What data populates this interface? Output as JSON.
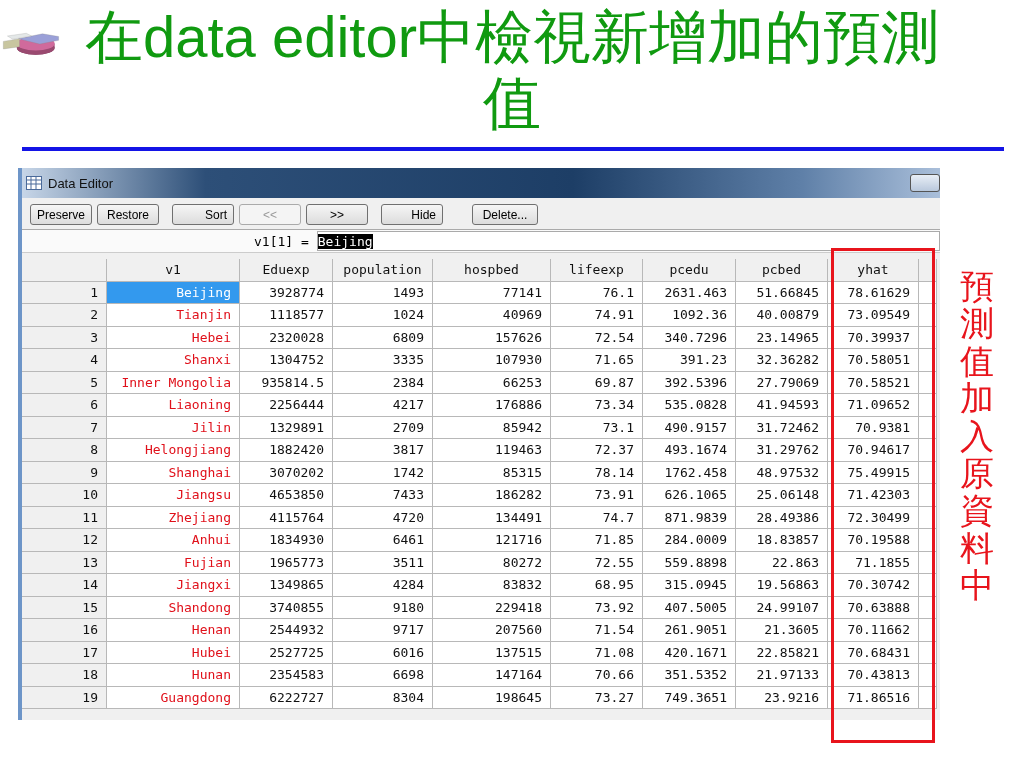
{
  "slide_title": "在data editor中檢視新增加的預測值",
  "window": {
    "title": "Data Editor"
  },
  "toolbar": [
    {
      "label": "Preserve",
      "disabled": false
    },
    {
      "label": "Restore",
      "disabled": false
    },
    {
      "label": "Sort",
      "disabled": false
    },
    {
      "label": "<<",
      "disabled": true
    },
    {
      "label": ">>",
      "disabled": false
    },
    {
      "label": "Hide",
      "disabled": false
    },
    {
      "label": "Delete...",
      "disabled": false
    }
  ],
  "cell_reference": {
    "label": "v1[1]  =",
    "value": "Beijing"
  },
  "table": {
    "columns": [
      "v1",
      "Eduexp",
      "population",
      "hospbed",
      "lifeexp",
      "pcedu",
      "pcbed",
      "yhat"
    ],
    "rows": [
      {
        "number": "1",
        "selected": true,
        "cells": [
          "Beijing",
          "3928774",
          "1493",
          "77141",
          "76.1",
          "2631.463",
          "51.66845",
          "78.61629"
        ]
      },
      {
        "number": "2",
        "selected": false,
        "cells": [
          "Tianjin",
          "1118577",
          "1024",
          "40969",
          "74.91",
          "1092.36",
          "40.00879",
          "73.09549"
        ]
      },
      {
        "number": "3",
        "selected": false,
        "cells": [
          "Hebei",
          "2320028",
          "6809",
          "157626",
          "72.54",
          "340.7296",
          "23.14965",
          "70.39937"
        ]
      },
      {
        "number": "4",
        "selected": false,
        "cells": [
          "Shanxi",
          "1304752",
          "3335",
          "107930",
          "71.65",
          "391.23",
          "32.36282",
          "70.58051"
        ]
      },
      {
        "number": "5",
        "selected": false,
        "cells": [
          "Inner Mongolia",
          "935814.5",
          "2384",
          "66253",
          "69.87",
          "392.5396",
          "27.79069",
          "70.58521"
        ]
      },
      {
        "number": "6",
        "selected": false,
        "cells": [
          "Liaoning",
          "2256444",
          "4217",
          "176886",
          "73.34",
          "535.0828",
          "41.94593",
          "71.09652"
        ]
      },
      {
        "number": "7",
        "selected": false,
        "cells": [
          "Jilin",
          "1329891",
          "2709",
          "85942",
          "73.1",
          "490.9157",
          "31.72462",
          "70.9381"
        ]
      },
      {
        "number": "8",
        "selected": false,
        "cells": [
          "Helongjiang",
          "1882420",
          "3817",
          "119463",
          "72.37",
          "493.1674",
          "31.29762",
          "70.94617"
        ]
      },
      {
        "number": "9",
        "selected": false,
        "cells": [
          "Shanghai",
          "3070202",
          "1742",
          "85315",
          "78.14",
          "1762.458",
          "48.97532",
          "75.49915"
        ]
      },
      {
        "number": "10",
        "selected": false,
        "cells": [
          "Jiangsu",
          "4653850",
          "7433",
          "186282",
          "73.91",
          "626.1065",
          "25.06148",
          "71.42303"
        ]
      },
      {
        "number": "11",
        "selected": false,
        "cells": [
          "Zhejiang",
          "4115764",
          "4720",
          "134491",
          "74.7",
          "871.9839",
          "28.49386",
          "72.30499"
        ]
      },
      {
        "number": "12",
        "selected": false,
        "cells": [
          "Anhui",
          "1834930",
          "6461",
          "121716",
          "71.85",
          "284.0009",
          "18.83857",
          "70.19588"
        ]
      },
      {
        "number": "13",
        "selected": false,
        "cells": [
          "Fujian",
          "1965773",
          "3511",
          "80272",
          "72.55",
          "559.8898",
          "22.863",
          "71.1855"
        ]
      },
      {
        "number": "14",
        "selected": false,
        "cells": [
          "Jiangxi",
          "1349865",
          "4284",
          "83832",
          "68.95",
          "315.0945",
          "19.56863",
          "70.30742"
        ]
      },
      {
        "number": "15",
        "selected": false,
        "cells": [
          "Shandong",
          "3740855",
          "9180",
          "229418",
          "73.92",
          "407.5005",
          "24.99107",
          "70.63888"
        ]
      },
      {
        "number": "16",
        "selected": false,
        "cells": [
          "Henan",
          "2544932",
          "9717",
          "207560",
          "71.54",
          "261.9051",
          "21.3605",
          "70.11662"
        ]
      },
      {
        "number": "17",
        "selected": false,
        "cells": [
          "Hubei",
          "2527725",
          "6016",
          "137515",
          "71.08",
          "420.1671",
          "22.85821",
          "70.68431"
        ]
      },
      {
        "number": "18",
        "selected": false,
        "cells": [
          "Hunan",
          "2354583",
          "6698",
          "147164",
          "70.66",
          "351.5352",
          "21.97133",
          "70.43813"
        ]
      },
      {
        "number": "19",
        "selected": false,
        "cells": [
          "Guangdong",
          "6222727",
          "8304",
          "198645",
          "73.27",
          "749.3651",
          "23.9216",
          "71.86516"
        ]
      }
    ]
  },
  "side_note": "預測值加入原資料中"
}
